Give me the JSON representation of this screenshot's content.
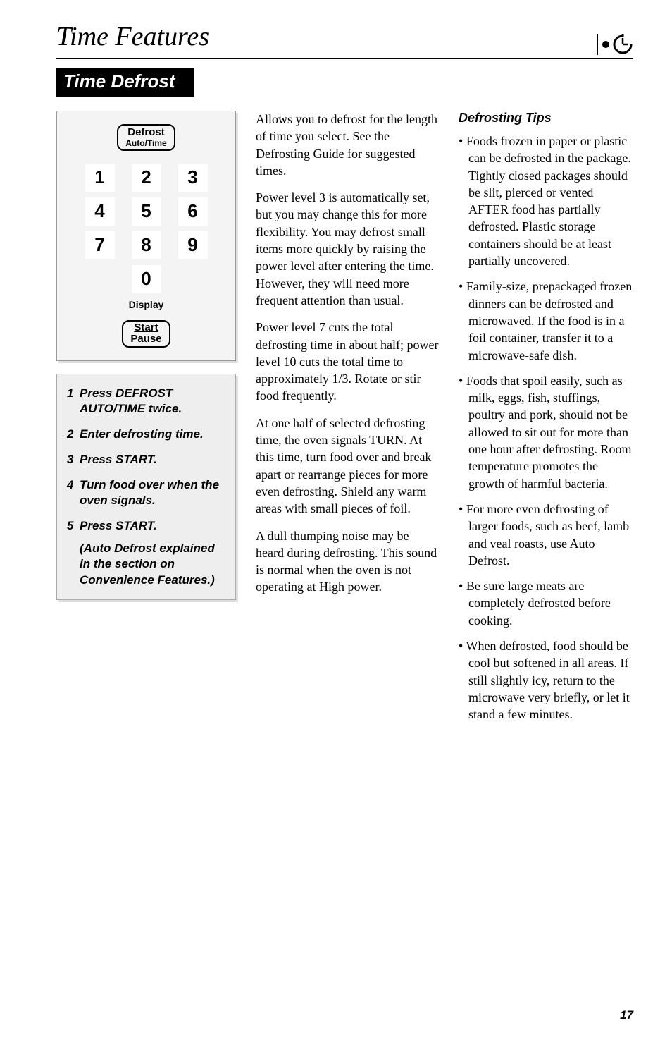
{
  "page": {
    "title": "Time Features",
    "section": "Time Defrost",
    "pageNumber": "17"
  },
  "panel": {
    "defrostTop": "Defrost",
    "defrostBottom": "Auto/Time",
    "keys": [
      "1",
      "2",
      "3",
      "4",
      "5",
      "6",
      "7",
      "8",
      "9"
    ],
    "zero": "0",
    "display": "Display",
    "startTop": "Start",
    "startBottom": "Pause"
  },
  "steps": {
    "s1": "Press DEFROST AUTO/TIME twice.",
    "s2": "Enter defrosting time.",
    "s3": "Press START.",
    "s4": "Turn food over when the oven signals.",
    "s5": "Press START.",
    "note": "(Auto Defrost explained in the section on Convenience Features.)"
  },
  "body": {
    "p1": "Allows you to defrost for the length of time you select. See the Defrosting Guide for suggested times.",
    "p2": "Power level 3 is automatically set, but you may change this for more flexibility. You may defrost small items more quickly by raising the power level after entering the time. However, they will need more frequent attention than usual.",
    "p3": "Power level 7 cuts the total defrosting time in about half; power level 10 cuts the total time to approximately 1/3. Rotate or stir food frequently.",
    "p4": "At one half of selected defrosting time, the oven signals TURN. At this time, turn food over and break apart or rearrange pieces for more even defrosting. Shield any warm areas with small pieces of foil.",
    "p5": "A dull thumping noise may be heard during defrosting. This sound is normal when the oven is not operating at High power."
  },
  "tips": {
    "heading": "Defrosting Tips",
    "t1": "Foods frozen in paper or plastic can be defrosted in the package. Tightly closed packages should be slit, pierced or vented AFTER food has partially defrosted. Plastic storage containers should be at least partially uncovered.",
    "t2": "Family-size, prepackaged frozen dinners can be defrosted and microwaved. If the food is in a foil container, transfer it to a microwave-safe dish.",
    "t3": "Foods that spoil easily, such as milk, eggs, fish, stuffings, poultry and pork, should not be allowed to sit out for more than one hour after defrosting. Room temperature promotes the growth of harmful bacteria.",
    "t4": "For more even defrosting of larger foods, such as beef, lamb and veal roasts, use Auto Defrost.",
    "t5": "Be sure large meats are completely defrosted before cooking.",
    "t6": "When defrosted, food should be cool but softened in all areas. If still slightly icy, return to the microwave very briefly, or let it stand a few minutes."
  }
}
